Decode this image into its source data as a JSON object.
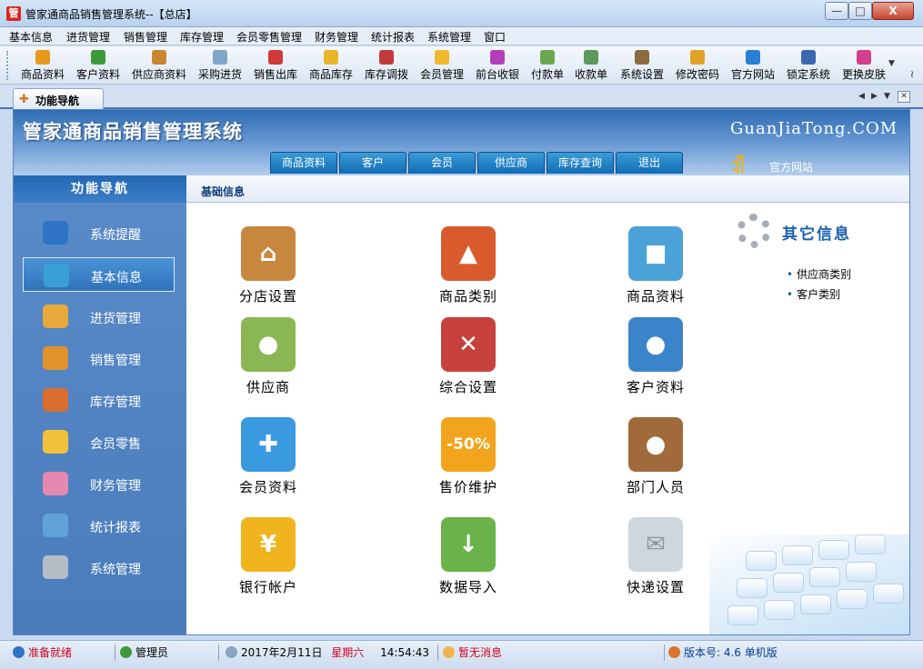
{
  "window": {
    "title": "管家通商品销售管理系统--【总店】",
    "logo_glyph": "管",
    "minimize": "—",
    "maximize": "□",
    "close": "X"
  },
  "menu": [
    "基本信息",
    "进货管理",
    "销售管理",
    "库存管理",
    "会员零售管理",
    "财务管理",
    "统计报表",
    "系统管理",
    "窗口"
  ],
  "toolbar": [
    {
      "label": "商品资料",
      "color": "#e59a1e"
    },
    {
      "label": "客户资料",
      "color": "#3c9a3a"
    },
    {
      "label": "供应商资料",
      "color": "#c98531"
    },
    {
      "label": "采购进货",
      "color": "#7fa6c9"
    },
    {
      "label": "销售出库",
      "color": "#d2393a"
    },
    {
      "label": "商品库存",
      "color": "#e8b52a"
    },
    {
      "label": "库存调拨",
      "color": "#c23b3b"
    },
    {
      "label": "会员管理",
      "color": "#f0b92e"
    },
    {
      "label": "前台收银",
      "color": "#b53fb8"
    },
    {
      "label": "付款单",
      "color": "#6aa84f"
    },
    {
      "label": "收款单",
      "color": "#5b9a5b"
    },
    {
      "label": "系统设置",
      "color": "#8a6b3b"
    },
    {
      "label": "修改密码",
      "color": "#e0a127"
    },
    {
      "label": "官方网站",
      "color": "#2a7fd4"
    },
    {
      "label": "锁定系统",
      "color": "#3d68b0"
    },
    {
      "label": "更换皮肤",
      "color": "#d43f8d"
    }
  ],
  "toolbar_more": "▼",
  "toolbar_edge": "≀",
  "tabs": {
    "active": "功能导航",
    "icon": "✚",
    "nav_left": "◀",
    "nav_right": "▶",
    "nav_down": "▼",
    "close": "✕"
  },
  "banner": {
    "title": "管家通商品销售管理系统",
    "site": "GuanJiaTong.COM",
    "tabs": [
      "商品资料",
      "客户",
      "会员",
      "供应商",
      "库存查询",
      "退出"
    ],
    "runner_glyph": "ꀊ",
    "official_link": "官方网站"
  },
  "sidebar": {
    "header": "功能导航",
    "items": [
      {
        "label": "系统提醒",
        "color": "#2f74c4",
        "active": false
      },
      {
        "label": "基本信息",
        "color": "#3aa0d8",
        "active": true
      },
      {
        "label": "进货管理",
        "color": "#e7a93a",
        "active": false
      },
      {
        "label": "销售管理",
        "color": "#e0922b",
        "active": false
      },
      {
        "label": "库存管理",
        "color": "#d96e2f",
        "active": false
      },
      {
        "label": "会员零售",
        "color": "#f2c23d",
        "active": false
      },
      {
        "label": "财务管理",
        "color": "#e589b0",
        "active": false
      },
      {
        "label": "统计报表",
        "color": "#5fa3d8",
        "active": false
      },
      {
        "label": "系统管理",
        "color": "#b4bcc6",
        "active": false
      }
    ]
  },
  "content": {
    "title": "基础信息",
    "tiles": [
      {
        "label": "分店设置",
        "color": "#c8873f",
        "glyph": "⌂"
      },
      {
        "label": "商品类别",
        "color": "#d95b2d",
        "glyph": "▲"
      },
      {
        "label": "商品资料",
        "color": "#4aa2d8",
        "glyph": "■"
      },
      {
        "label": "供应商",
        "color": "#8ab653",
        "glyph": "●"
      },
      {
        "label": "综合设置",
        "color": "#c6413b",
        "glyph": "✕"
      },
      {
        "label": "客户资料",
        "color": "#3b84c9",
        "glyph": "●"
      },
      {
        "label": "会员资料",
        "color": "#3a9ae0",
        "glyph": "✚"
      },
      {
        "label": "售价维护",
        "color": "#f2a41c",
        "glyph": "-50%"
      },
      {
        "label": "部门人员",
        "color": "#a06a3a",
        "glyph": "●"
      },
      {
        "label": "银行帐户",
        "color": "#f0b41f",
        "glyph": "¥"
      },
      {
        "label": "数据导入",
        "color": "#69b34a",
        "glyph": "↓"
      },
      {
        "label": "快递设置",
        "color": "#cfd6dd",
        "glyph": "✉"
      }
    ],
    "other": {
      "title": "其它信息",
      "links": [
        "供应商类别",
        "客户类别"
      ],
      "bullet": "•"
    }
  },
  "status": {
    "ready": "准备就绪",
    "user": "管理员",
    "date": "2017年2月11日",
    "weekday": "星期六",
    "time": "14:54:43",
    "message": "暂无消息",
    "version": "版本号: 4.6 单机版"
  },
  "colors": {
    "accent_blue": "#2f6cb3",
    "status_red": "#d0021b",
    "status_blue": "#0b3d91"
  }
}
